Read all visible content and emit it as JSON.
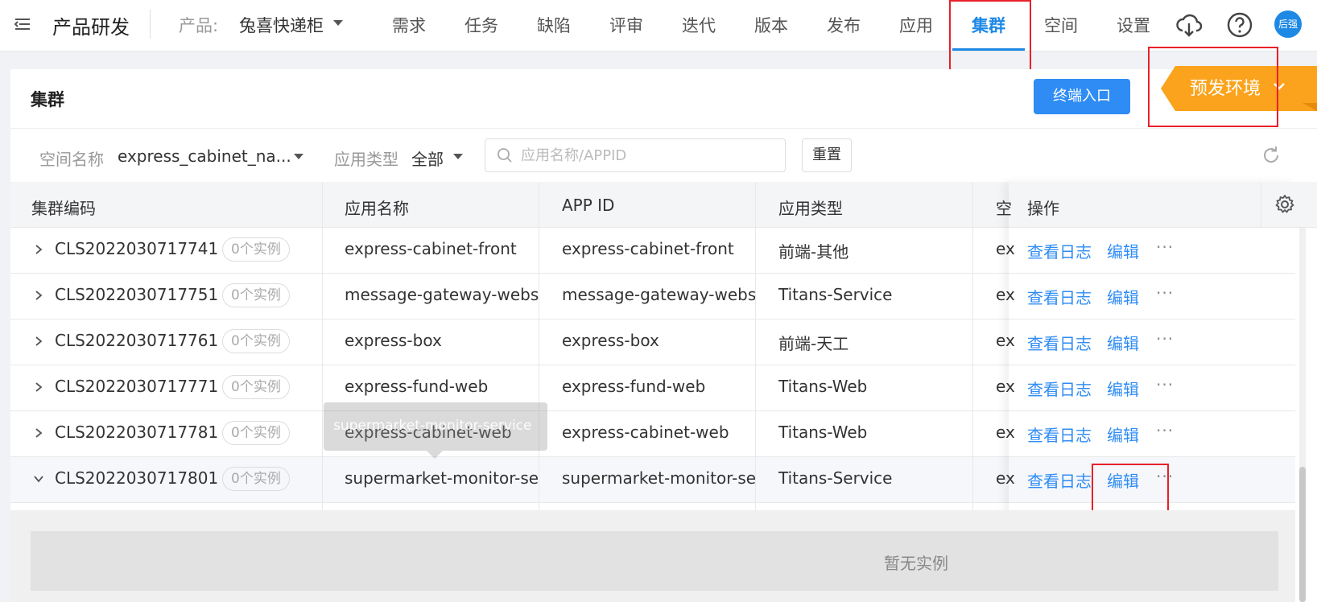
{
  "header": {
    "brand": "产品研发",
    "product_label": "产品:",
    "product_value": "兔喜快递柜",
    "nav": [
      {
        "label": "需求"
      },
      {
        "label": "任务"
      },
      {
        "label": "缺陷"
      },
      {
        "label": "评审"
      },
      {
        "label": "迭代"
      },
      {
        "label": "版本"
      },
      {
        "label": "发布"
      },
      {
        "label": "应用"
      },
      {
        "label": "集群"
      },
      {
        "label": "空间"
      },
      {
        "label": "设置"
      }
    ],
    "avatar_text": "后强"
  },
  "card": {
    "title": "集群",
    "terminal_button": "终端入口",
    "env_selector": "预发环境"
  },
  "filters": {
    "space_label": "空间名称",
    "space_value": "express_cabinet_na...",
    "type_label": "应用类型",
    "type_value": "全部",
    "search_placeholder": "应用名称/APPID",
    "reset_label": "重置"
  },
  "table": {
    "headers": [
      "集群编码",
      "应用名称",
      "APP ID",
      "应用类型",
      "空",
      "操作"
    ],
    "rows": [
      {
        "code": "CLS2022030717741",
        "instances": "0个实例",
        "app_name": "express-cabinet-front",
        "app_id": "express-cabinet-front",
        "app_type": "前端-其他",
        "space": "ex",
        "expanded": false
      },
      {
        "code": "CLS2022030717751",
        "instances": "0个实例",
        "app_name": "message-gateway-webs",
        "app_id": "message-gateway-webs",
        "app_type": "Titans-Service",
        "space": "ex",
        "expanded": false
      },
      {
        "code": "CLS2022030717761",
        "instances": "0个实例",
        "app_name": "express-box",
        "app_id": "express-box",
        "app_type": "前端-天工",
        "space": "ex",
        "expanded": false
      },
      {
        "code": "CLS2022030717771",
        "instances": "0个实例",
        "app_name": "express-fund-web",
        "app_id": "express-fund-web",
        "app_type": "Titans-Web",
        "space": "ex",
        "expanded": false
      },
      {
        "code": "CLS2022030717781",
        "instances": "0个实例",
        "app_name": "express-cabinet-web",
        "app_id": "express-cabinet-web",
        "app_type": "Titans-Web",
        "space": "ex",
        "expanded": false
      },
      {
        "code": "CLS2022030717801",
        "instances": "0个实例",
        "app_name": "supermarket-monitor-se",
        "app_id": "supermarket-monitor-se",
        "app_type": "Titans-Service",
        "space": "ex",
        "expanded": true
      }
    ],
    "action_view_logs": "查看日志",
    "action_edit": "编辑",
    "action_more": "···"
  },
  "expanded": {
    "empty_text": "暂无实例"
  },
  "tooltip": {
    "text": "supermarket-monitor-service"
  }
}
